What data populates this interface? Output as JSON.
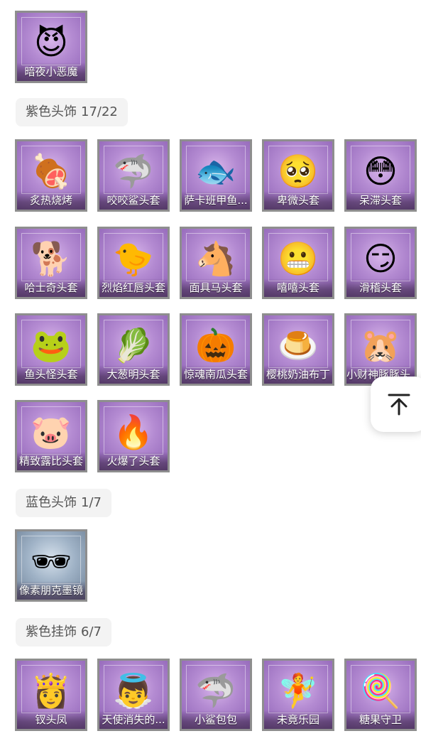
{
  "sections": {
    "top": {
      "items": [
        {
          "name": "暗夜小恶魔",
          "icon": "devil-girl-icon",
          "glyph": "😈"
        }
      ]
    },
    "purple_head": {
      "title": "紫色头饰",
      "count": "17/22",
      "items": [
        {
          "name": "炙热烧烤",
          "icon": "grill-meat-mask-icon",
          "glyph": "🍖"
        },
        {
          "name": "咬咬鲨头套",
          "icon": "shark-mask-icon",
          "glyph": "🦈"
        },
        {
          "name": "萨卡班甲鱼...",
          "icon": "fish-mask-icon",
          "glyph": "🐟"
        },
        {
          "name": "卑微头套",
          "icon": "humble-emoji-icon",
          "glyph": "🥺"
        },
        {
          "name": "呆滞头套",
          "icon": "dazed-emoji-icon",
          "glyph": "😳"
        },
        {
          "name": "哈士奇头套",
          "icon": "husky-mask-icon",
          "glyph": "🐕"
        },
        {
          "name": "烈焰红唇头套",
          "icon": "yellow-creature-mask-icon",
          "glyph": "🐤"
        },
        {
          "name": "面具马头套",
          "icon": "horse-mask-icon",
          "glyph": "🐴"
        },
        {
          "name": "嘻嘻头套",
          "icon": "grinning-emoji-icon",
          "glyph": "😬"
        },
        {
          "name": "滑稽头套",
          "icon": "silly-emoji-icon",
          "glyph": "😏"
        },
        {
          "name": "鱼头怪头套",
          "icon": "fish-head-mask-icon",
          "glyph": "🐸"
        },
        {
          "name": "大葱明头套",
          "icon": "scallion-mask-icon",
          "glyph": "🥬"
        },
        {
          "name": "惊魂南瓜头套",
          "icon": "pumpkin-mask-icon",
          "glyph": "🎃"
        },
        {
          "name": "樱桃奶油布丁",
          "icon": "pudding-mask-icon",
          "glyph": "🍮"
        },
        {
          "name": "小财神豚豚头...",
          "icon": "capybara-mask-icon",
          "glyph": "🐹"
        },
        {
          "name": "精致露比头套",
          "icon": "pink-ruby-mask-icon",
          "glyph": "🐷"
        },
        {
          "name": "火爆了头套",
          "icon": "fire-mask-icon",
          "glyph": "🔥"
        }
      ]
    },
    "blue_head": {
      "title": "蓝色头饰",
      "count": "1/7",
      "items": [
        {
          "name": "像素朋克墨镜",
          "icon": "pixel-sunglasses-icon",
          "glyph": "🕶"
        }
      ]
    },
    "purple_pendant": {
      "title": "紫色挂饰",
      "count": "6/7",
      "items": [
        {
          "name": "钗头凤",
          "icon": "phoenix-headdress-doll-icon",
          "glyph": "👸"
        },
        {
          "name": "天使消失的...",
          "icon": "angel-doll-icon",
          "glyph": "👼"
        },
        {
          "name": "小鲨包包",
          "icon": "shark-bag-icon",
          "glyph": "🦈"
        },
        {
          "name": "未竟乐园",
          "icon": "pink-hair-doll-icon",
          "glyph": "🧚"
        },
        {
          "name": "糖果守卫",
          "icon": "candy-guard-icon",
          "glyph": "🍭"
        }
      ]
    }
  },
  "scroll_top": {
    "icon": "arrow-up-to-top-icon"
  }
}
